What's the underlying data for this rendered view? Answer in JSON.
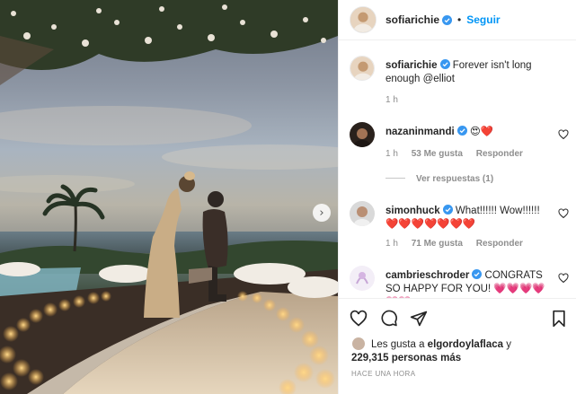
{
  "header": {
    "username": "sofiarichie",
    "separator": "•",
    "follow_label": "Seguir"
  },
  "caption": {
    "username": "sofiarichie",
    "text": "Forever isn't long enough @elliot",
    "time": "1 h"
  },
  "comments": [
    {
      "username": "nazaninmandi",
      "text": "😍❤️",
      "time": "1 h",
      "likes": "53 Me gusta",
      "reply": "Responder"
    },
    {
      "username": "simonhuck",
      "text": "What!!!!!! Wow!!!!!! ❤️❤️❤️❤️❤️❤️❤️",
      "time": "1 h",
      "likes": "71 Me gusta",
      "reply": "Responder"
    },
    {
      "username": "cambrieschroder",
      "text": "CONGRATS SO HAPPY FOR YOU! 💗💗💗💗💗💗"
    }
  ],
  "view_replies": "Ver respuestas (1)",
  "likes": {
    "prefix": "Les gusta a",
    "user": "elgordoylaflaca",
    "connector": "y",
    "count": "229,315 personas más"
  },
  "timestamp": "HACE UNA HORA",
  "icons": {
    "verified": "verified-badge-icon",
    "like": "heart-icon",
    "comment": "comment-icon",
    "share": "paper-plane-icon",
    "save": "bookmark-icon",
    "next": "chevron-right-icon"
  },
  "colors": {
    "accent": "#0095f6",
    "text": "#262626",
    "muted": "#8e8e8e",
    "border": "#efefef"
  }
}
